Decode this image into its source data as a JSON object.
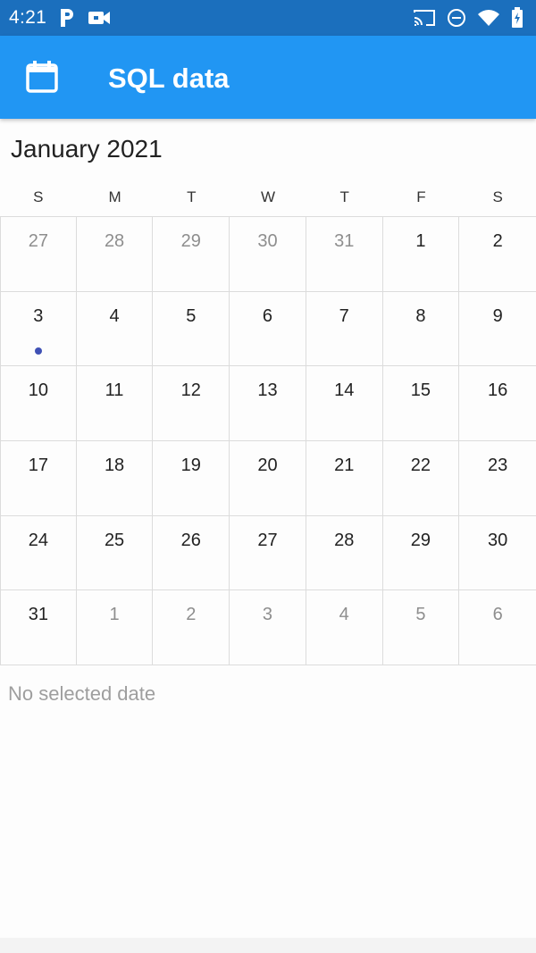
{
  "status_bar": {
    "time": "4:21",
    "icons": [
      "p-app-icon",
      "video-camera-icon",
      "cast-icon",
      "do-not-disturb-icon",
      "wifi-icon",
      "battery-icon"
    ]
  },
  "app_bar": {
    "icon": "calendar-icon",
    "title": "SQL data",
    "color": "#2196f3"
  },
  "calendar": {
    "month_label": "January 2021",
    "weekdays": [
      "S",
      "M",
      "T",
      "W",
      "T",
      "F",
      "S"
    ],
    "days": [
      {
        "label": "27",
        "muted": true
      },
      {
        "label": "28",
        "muted": true
      },
      {
        "label": "29",
        "muted": true
      },
      {
        "label": "30",
        "muted": true
      },
      {
        "label": "31",
        "muted": true
      },
      {
        "label": "1",
        "muted": false
      },
      {
        "label": "2",
        "muted": false
      },
      {
        "label": "3",
        "muted": false,
        "event": true
      },
      {
        "label": "4",
        "muted": false
      },
      {
        "label": "5",
        "muted": false
      },
      {
        "label": "6",
        "muted": false
      },
      {
        "label": "7",
        "muted": false
      },
      {
        "label": "8",
        "muted": false
      },
      {
        "label": "9",
        "muted": false
      },
      {
        "label": "10",
        "muted": false
      },
      {
        "label": "11",
        "muted": false
      },
      {
        "label": "12",
        "muted": false
      },
      {
        "label": "13",
        "muted": false
      },
      {
        "label": "14",
        "muted": false
      },
      {
        "label": "15",
        "muted": false
      },
      {
        "label": "16",
        "muted": false
      },
      {
        "label": "17",
        "muted": false
      },
      {
        "label": "18",
        "muted": false
      },
      {
        "label": "19",
        "muted": false
      },
      {
        "label": "20",
        "muted": false
      },
      {
        "label": "21",
        "muted": false
      },
      {
        "label": "22",
        "muted": false
      },
      {
        "label": "23",
        "muted": false
      },
      {
        "label": "24",
        "muted": false
      },
      {
        "label": "25",
        "muted": false
      },
      {
        "label": "26",
        "muted": false
      },
      {
        "label": "27",
        "muted": false
      },
      {
        "label": "28",
        "muted": false
      },
      {
        "label": "29",
        "muted": false
      },
      {
        "label": "30",
        "muted": false
      },
      {
        "label": "31",
        "muted": false
      },
      {
        "label": "1",
        "muted": true
      },
      {
        "label": "2",
        "muted": true
      },
      {
        "label": "3",
        "muted": true
      },
      {
        "label": "4",
        "muted": true
      },
      {
        "label": "5",
        "muted": true
      },
      {
        "label": "6",
        "muted": true
      }
    ],
    "event_dot_color": "#3f51b5"
  },
  "selection": {
    "text": "No selected date"
  }
}
